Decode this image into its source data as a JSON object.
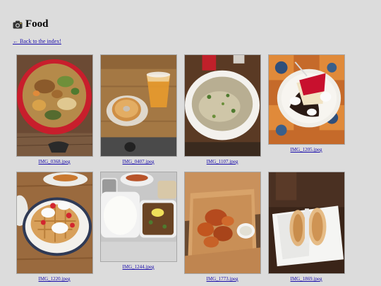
{
  "page": {
    "title": "Food",
    "title_icon": "camera-icon",
    "back_link": "← Back to the index!"
  },
  "gallery": {
    "items": [
      {
        "caption": "IMG_0368.jpeg",
        "depicts": "bowl of stir-fried noodles with vegetables"
      },
      {
        "caption": "IMG_0407.jpeg",
        "depicts": "glazed donut and iced tea"
      },
      {
        "caption": "IMG_1107.jpeg",
        "depicts": "bowl of pho noodle soup"
      },
      {
        "caption": "IMG_1205.jpeg",
        "depicts": "strawberry cheesecake slice with whipped cream"
      },
      {
        "caption": "IMG_1220.jpeg",
        "depicts": "waffle with strawberries and whipped cream"
      },
      {
        "caption": "IMG_1244.jpeg",
        "depicts": "rice and curry dishes"
      },
      {
        "caption": "IMG_1773.jpeg",
        "depicts": "boneless chicken wings in takeout box"
      },
      {
        "caption": "IMG_1869.jpeg",
        "depicts": "two bagel sandwiches on paper"
      }
    ]
  }
}
